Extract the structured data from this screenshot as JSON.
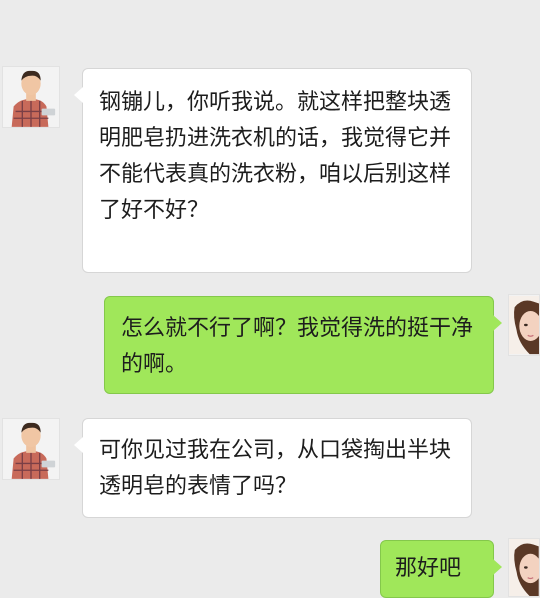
{
  "chat": {
    "messages": [
      {
        "sender": "other",
        "text": "钢镚儿，你听我说。就这样把整块透明肥皂扔进洗衣机的话，我觉得它并不能代表真的洗衣粉，咱以后别这样了好不好？"
      },
      {
        "sender": "me",
        "text": "怎么就不行了啊？我觉得洗的挺干净的啊。"
      },
      {
        "sender": "other",
        "text": "可你见过我在公司，从口袋掏出半块透明皂的表情了吗？"
      },
      {
        "sender": "me",
        "text": "那好吧"
      }
    ]
  },
  "colors": {
    "background": "#ebebeb",
    "incoming_bubble": "#ffffff",
    "outgoing_bubble": "#a0e75a"
  },
  "icons": {
    "contact_avatar": "man-avatar-icon",
    "self_avatar": "woman-avatar-icon"
  }
}
